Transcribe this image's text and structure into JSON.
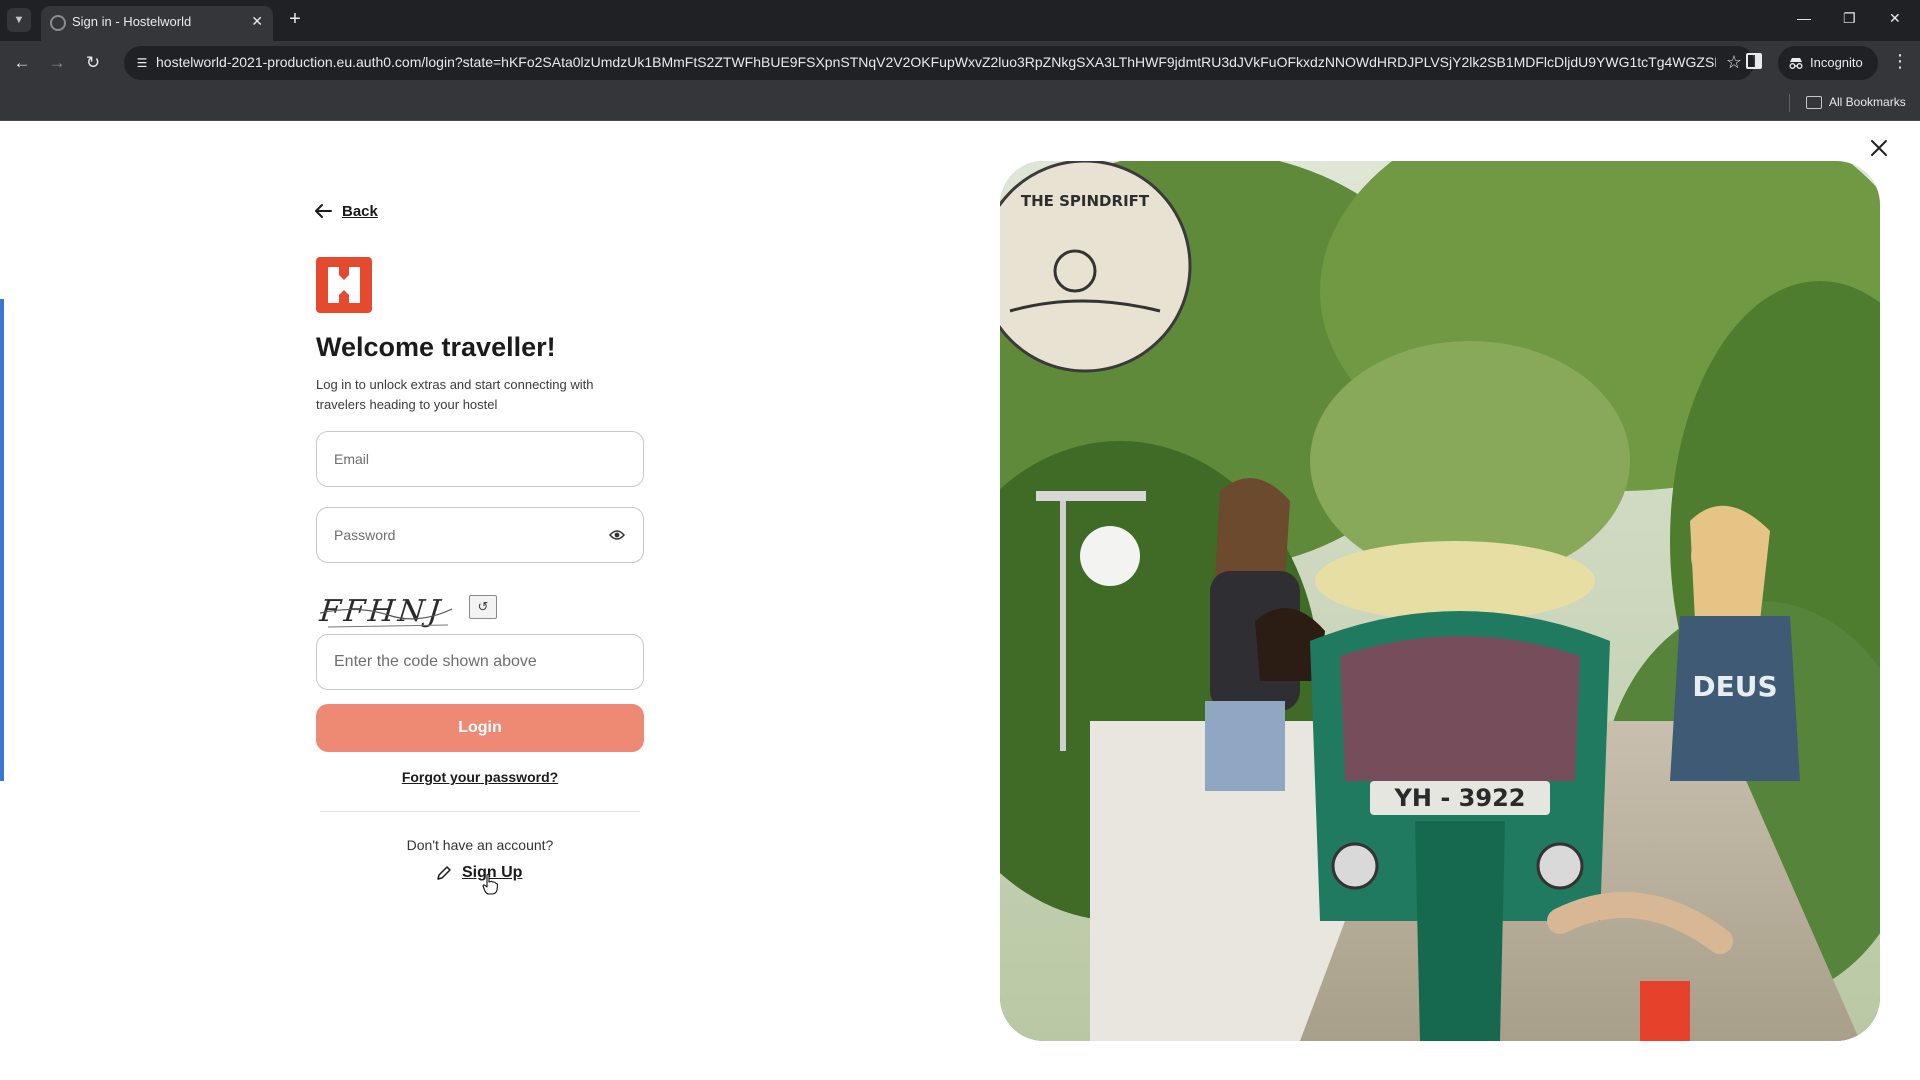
{
  "browser": {
    "tab_title": "Sign in - Hostelworld",
    "url": "hostelworld-2021-production.eu.auth0.com/login?state=hKFo2SAta0lzUmdzUk1BMmFtS2ZTWFhBUE9FSXpnSTNqV2V2OKFupWxvZ2luo3RpZNkgSXA3LThHWF9jdmtRU3dJVkFuOFkxdzNNOWdHRDJPLVSjY2lk2SB1MDFlcDljdU9YWG1tcTg4WGZSRFZ...",
    "incognito_label": "Incognito",
    "all_bookmarks_label": "All Bookmarks"
  },
  "login": {
    "back_label": "Back",
    "heading": "Welcome traveller!",
    "subtext": "Log in to unlock extras and start connecting with travelers heading to your hostel",
    "email_placeholder": "Email",
    "password_placeholder": "Password",
    "captcha_text": "FFHNJ",
    "code_placeholder": "Enter the code shown above",
    "login_label": "Login",
    "forgot_label": "Forgot your password?",
    "no_account_text": "Don't have an account?",
    "signup_label": "Sign Up"
  },
  "hero": {
    "sign_text": "THE SPINDRIFT",
    "plate_text": "YH - 3922",
    "shirt_text": "DEUS"
  },
  "colors": {
    "brand": "#e64a2e",
    "login_button": "#ee8a73",
    "accent_bar": "#3b76d6"
  }
}
